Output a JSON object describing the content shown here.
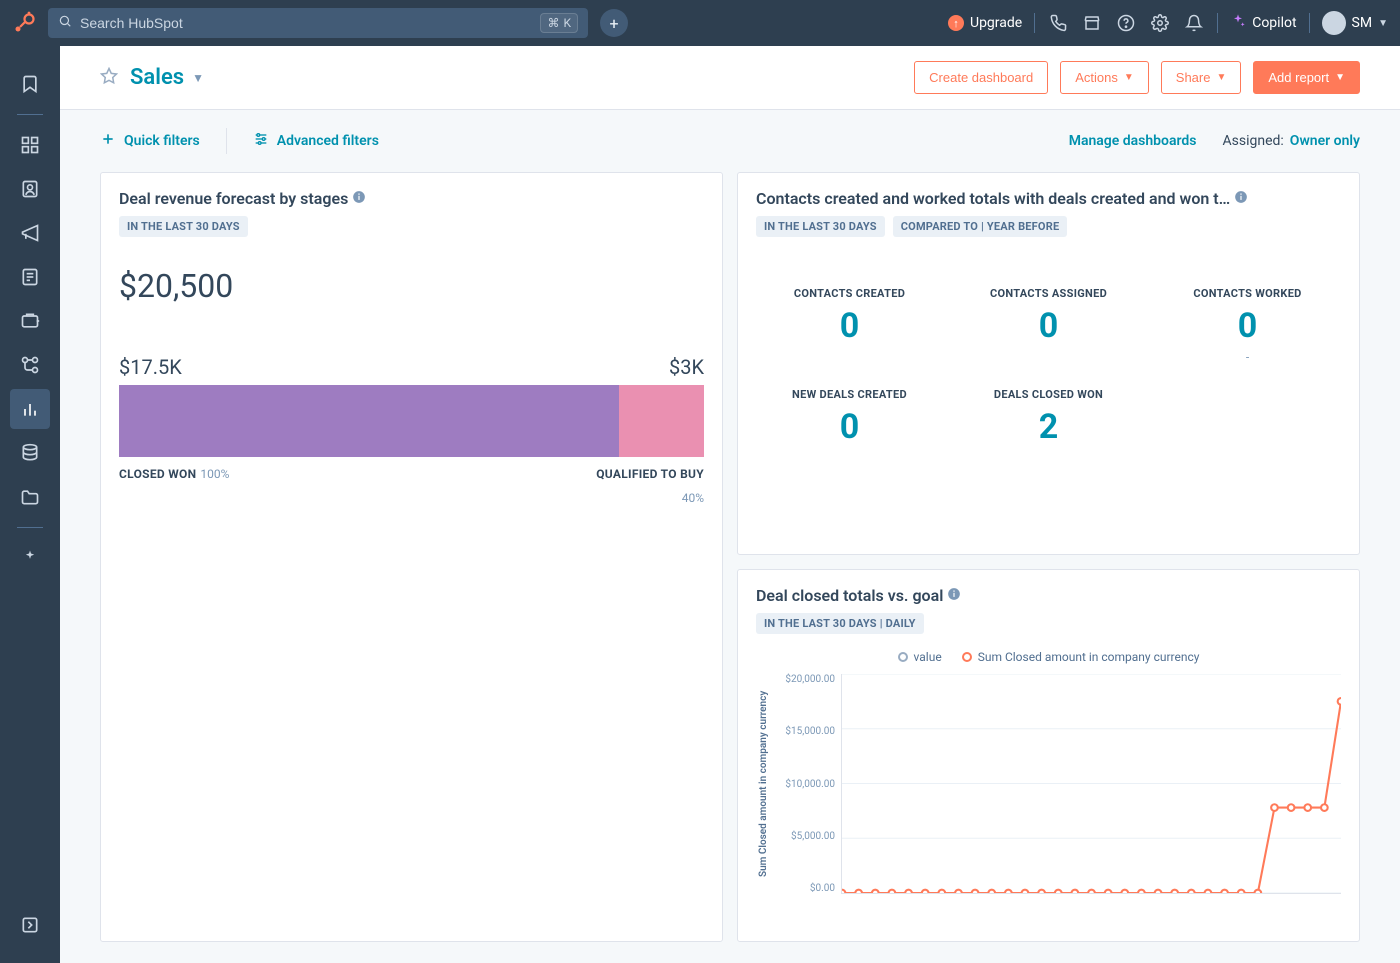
{
  "topnav": {
    "search_placeholder": "Search HubSpot",
    "shortcut_symbol": "⌘",
    "shortcut_key": "K",
    "upgrade_label": "Upgrade",
    "copilot_label": "Copilot",
    "account_initials": "SM"
  },
  "header": {
    "title": "Sales",
    "create_dashboard_label": "Create dashboard",
    "actions_label": "Actions",
    "share_label": "Share",
    "add_report_label": "Add report"
  },
  "filters": {
    "quick_label": "Quick filters",
    "advanced_label": "Advanced filters",
    "manage_label": "Manage dashboards",
    "assigned_label": "Assigned:",
    "assigned_value": "Owner only"
  },
  "cardA": {
    "title": "Deal revenue forecast by stages",
    "chip1": "IN THE LAST 30 DAYS",
    "total": "$20,500",
    "seg1_amount": "$17.5K",
    "seg2_amount": "$3K",
    "seg1_name": "CLOSED WON",
    "seg1_pct": "100%",
    "seg2_name": "QUALIFIED TO BUY",
    "seg2_pct": "40%"
  },
  "cardB": {
    "title": "Contacts created and worked totals with deals created and won t…",
    "chip1": "IN THE LAST 30 DAYS",
    "chip2": "COMPARED TO | YEAR BEFORE",
    "kpis": [
      {
        "label": "CONTACTS CREATED",
        "value": "0",
        "sub": ""
      },
      {
        "label": "CONTACTS ASSIGNED",
        "value": "0",
        "sub": ""
      },
      {
        "label": "CONTACTS WORKED",
        "value": "0",
        "sub": "-"
      },
      {
        "label": "NEW DEALS CREATED",
        "value": "0",
        "sub": ""
      },
      {
        "label": "DEALS CLOSED WON",
        "value": "2",
        "sub": ""
      }
    ]
  },
  "cardC": {
    "title": "Deal closed totals vs. goal",
    "chip1": "IN THE LAST 30 DAYS | DAILY",
    "legend1": "value",
    "legend2": "Sum Closed amount in company currency",
    "ylabel": "Sum Closed amount in company currency",
    "yticks": [
      "$20,000.00",
      "$15,000.00",
      "$10,000.00",
      "$5,000.00",
      "$0.00"
    ]
  },
  "chart_data": [
    {
      "type": "bar",
      "title": "Deal revenue forecast by stages",
      "orientation": "horizontal-stacked-single",
      "total_label": "$20,500",
      "series": [
        {
          "name": "CLOSED WON",
          "value": 17500,
          "pct_label": "100%",
          "color": "#9e7cc1"
        },
        {
          "name": "QUALIFIED TO BUY",
          "value": 3000,
          "pct_label": "40%",
          "color": "#ea90b1"
        }
      ]
    },
    {
      "type": "line",
      "title": "Deal closed totals vs. goal",
      "ylabel": "Sum Closed amount in company currency",
      "ylim": [
        0,
        20000
      ],
      "x_count": 31,
      "series": [
        {
          "name": "Sum Closed amount in company currency",
          "color": "#ff7a59",
          "values": [
            0,
            0,
            0,
            0,
            0,
            0,
            0,
            0,
            0,
            0,
            0,
            0,
            0,
            0,
            0,
            0,
            0,
            0,
            0,
            0,
            0,
            0,
            0,
            0,
            0,
            0,
            7800,
            7800,
            7800,
            7800,
            17500
          ]
        }
      ],
      "legend": [
        "value",
        "Sum Closed amount in company currency"
      ]
    }
  ]
}
